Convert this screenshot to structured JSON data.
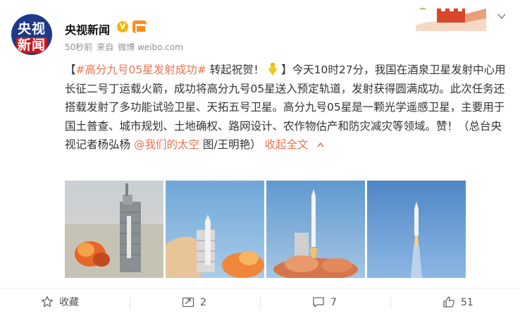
{
  "author": {
    "avatar_top": "央视",
    "avatar_bottom": "新闻",
    "name": "央视新闻",
    "verified_mark": "V"
  },
  "meta": {
    "time": "50秒前",
    "source_prefix": "来自",
    "source": "微博 weibo.com"
  },
  "post": {
    "bracket_open": "【",
    "hashtag": "#高分九号05星发射成功#",
    "after_tag": " 转起祝贺！",
    "hand_icon": "pointing-down-hand-emoji",
    "body": "】今天10时27分，我国在酒泉卫星发射中心用长征二号丁运载火箭，成功将高分九号05星送入预定轨道，发射获得圆满成功。此次任务还搭载发射了多功能试验卫星、天拓五号卫星。高分九号05星是一颗光学遥感卫星，主要用于国土普查、城市规划、土地确权、路网设计、农作物估产和防灾减灾等领域。赞！（总台央视记者杨弘杨 ",
    "mention": "@我们的太空",
    "credit": " 图/王明艳）",
    "collapse_label": "收起全文",
    "collapse_icon": "chevron-up-icon"
  },
  "images": [
    {
      "name": "launch-photo-1",
      "subject": "rocket on launch tower with fire"
    },
    {
      "name": "launch-photo-2",
      "subject": "rocket lifting off beside tower"
    },
    {
      "name": "launch-photo-3",
      "subject": "rocket rising from pad with smoke"
    },
    {
      "name": "launch-photo-4",
      "subject": "rocket ascending in blue sky"
    }
  ],
  "actions": {
    "collect_label": "收藏",
    "repost_count": "2",
    "comment_count": "7",
    "like_count": "51"
  },
  "colors": {
    "link": "#eb7350",
    "text": "#333333",
    "meta": "#939393",
    "avatar_bg": "#1d3a8a",
    "avatar_red": "#c8171e",
    "verified": "#f7b500"
  }
}
